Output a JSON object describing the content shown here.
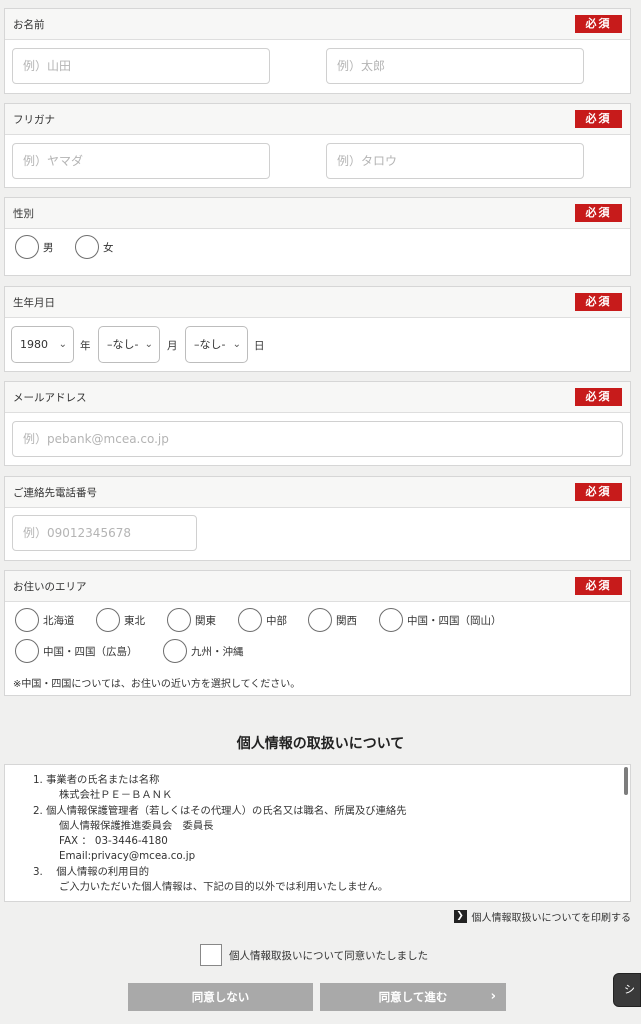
{
  "required_label": "必須",
  "name": {
    "title": "お名前",
    "last_placeholder": "例）山田",
    "first_placeholder": "例）太郎"
  },
  "furigana": {
    "title": "フリガナ",
    "last_placeholder": "例）ヤマダ",
    "first_placeholder": "例）タロウ"
  },
  "gender": {
    "title": "性別",
    "options": [
      "男",
      "女"
    ]
  },
  "birthdate": {
    "title": "生年月日",
    "year_value": "1980",
    "year_unit": "年",
    "month_value": "–なし-",
    "month_unit": "月",
    "day_value": "–なし-",
    "day_unit": "日"
  },
  "email": {
    "title": "メールアドレス",
    "placeholder": "例）pebank@mcea.co.jp"
  },
  "phone": {
    "title": "ご連絡先電話番号",
    "placeholder": "例）09012345678"
  },
  "area": {
    "title": "お住いのエリア",
    "options": [
      "北海道",
      "東北",
      "関東",
      "中部",
      "関西",
      "中国・四国（岡山）",
      "中国・四国（広島）",
      "九州・沖縄"
    ],
    "note": "※中国・四国については、お住いの近い方を選択してください。"
  },
  "privacy": {
    "title": "個人情報の取扱いについて",
    "lines": [
      "1. 事業者の氏名または名称",
      "株式会社ＰＥ－ＢＡＮＫ",
      "2. 個人情報保護管理者（若しくはその代理人）の氏名又は職名、所属及び連絡先",
      "個人情報保護推進委員会　委員長",
      "FAX ： 03-3446-4180",
      "Email:privacy@mcea.co.jp",
      "3.　 個人情報の利用目的",
      "ご入力いただいた個人情報は、下記の目的以外では利用いたしません。"
    ],
    "print_link": "個人情報取扱いについてを印刷する",
    "agree_label": "個人情報取扱いについて同意いたしました"
  },
  "buttons": {
    "disagree": "同意しない",
    "agree_next": "同意して進む",
    "floating": "シ"
  }
}
